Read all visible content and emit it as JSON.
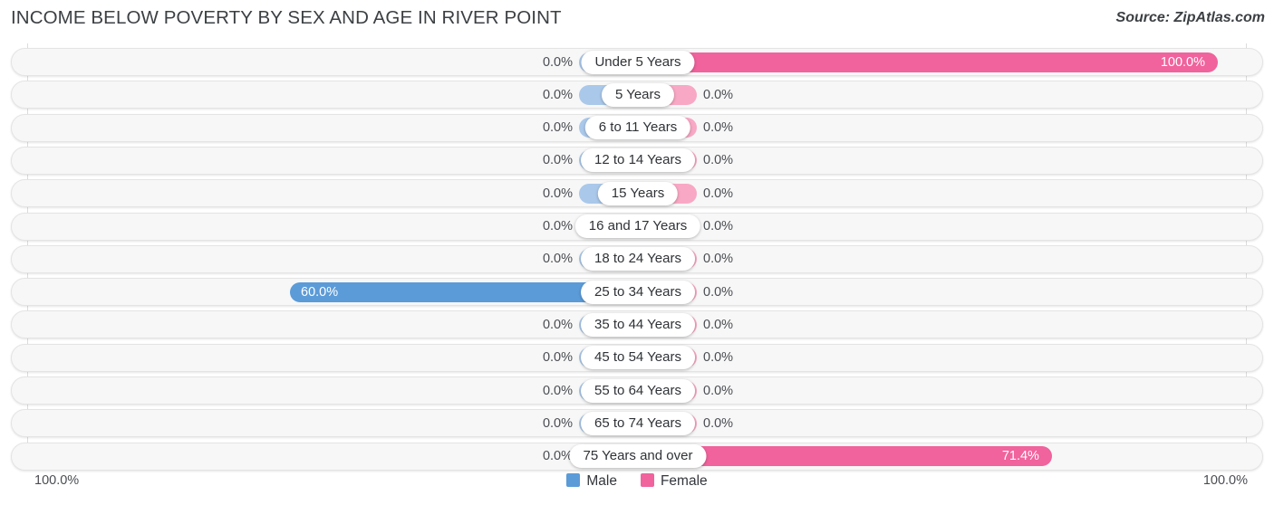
{
  "header": {
    "title": "INCOME BELOW POVERTY BY SEX AND AGE IN RIVER POINT",
    "source": "Source: ZipAtlas.com"
  },
  "axis": {
    "left_end": "100.0%",
    "right_end": "100.0%"
  },
  "legend": {
    "male_label": "Male",
    "female_label": "Female",
    "male_color": "#5b9bd8",
    "female_color": "#f0639c"
  },
  "colors": {
    "male_zero": "#aac8ea",
    "female_zero": "#f8a8c4",
    "male_filled": "#5b9bd8",
    "female_filled": "#f0639c",
    "row_background": "#f7f7f7",
    "gridline": "#dcdcdc"
  },
  "chart_data": {
    "type": "bar",
    "title": "INCOME BELOW POVERTY BY SEX AND AGE IN RIVER POINT",
    "subtitle": "Source: ZipAtlas.com",
    "orientation": "horizontal-diverging",
    "xlabel": "",
    "ylabel": "",
    "xlim": [
      -100,
      100
    ],
    "axis_tick_labels": [
      "100.0%",
      "100.0%"
    ],
    "grid": true,
    "legend_position": "bottom-center",
    "categories": [
      "Under 5 Years",
      "5 Years",
      "6 to 11 Years",
      "12 to 14 Years",
      "15 Years",
      "16 and 17 Years",
      "18 to 24 Years",
      "25 to 34 Years",
      "35 to 44 Years",
      "45 to 54 Years",
      "55 to 64 Years",
      "65 to 74 Years",
      "75 Years and over"
    ],
    "series": [
      {
        "name": "Male",
        "values": [
          0.0,
          0.0,
          0.0,
          0.0,
          0.0,
          0.0,
          0.0,
          60.0,
          0.0,
          0.0,
          0.0,
          0.0,
          0.0
        ]
      },
      {
        "name": "Female",
        "values": [
          100.0,
          0.0,
          0.0,
          0.0,
          0.0,
          0.0,
          0.0,
          0.0,
          0.0,
          0.0,
          0.0,
          0.0,
          71.4
        ]
      }
    ]
  },
  "rows": [
    {
      "label": "Under 5 Years",
      "male": "0.0%",
      "female": "100.0%",
      "male_pct": 0.0,
      "female_pct": 100.0
    },
    {
      "label": "5 Years",
      "male": "0.0%",
      "female": "0.0%",
      "male_pct": 0.0,
      "female_pct": 0.0
    },
    {
      "label": "6 to 11 Years",
      "male": "0.0%",
      "female": "0.0%",
      "male_pct": 0.0,
      "female_pct": 0.0
    },
    {
      "label": "12 to 14 Years",
      "male": "0.0%",
      "female": "0.0%",
      "male_pct": 0.0,
      "female_pct": 0.0
    },
    {
      "label": "15 Years",
      "male": "0.0%",
      "female": "0.0%",
      "male_pct": 0.0,
      "female_pct": 0.0
    },
    {
      "label": "16 and 17 Years",
      "male": "0.0%",
      "female": "0.0%",
      "male_pct": 0.0,
      "female_pct": 0.0
    },
    {
      "label": "18 to 24 Years",
      "male": "0.0%",
      "female": "0.0%",
      "male_pct": 0.0,
      "female_pct": 0.0
    },
    {
      "label": "25 to 34 Years",
      "male": "60.0%",
      "female": "0.0%",
      "male_pct": 60.0,
      "female_pct": 0.0
    },
    {
      "label": "35 to 44 Years",
      "male": "0.0%",
      "female": "0.0%",
      "male_pct": 0.0,
      "female_pct": 0.0
    },
    {
      "label": "45 to 54 Years",
      "male": "0.0%",
      "female": "0.0%",
      "male_pct": 0.0,
      "female_pct": 0.0
    },
    {
      "label": "55 to 64 Years",
      "male": "0.0%",
      "female": "0.0%",
      "male_pct": 0.0,
      "female_pct": 0.0
    },
    {
      "label": "65 to 74 Years",
      "male": "0.0%",
      "female": "0.0%",
      "male_pct": 0.0,
      "female_pct": 0.0
    },
    {
      "label": "75 Years and over",
      "male": "0.0%",
      "female": "71.4%",
      "male_pct": 0.0,
      "female_pct": 71.4
    }
  ]
}
